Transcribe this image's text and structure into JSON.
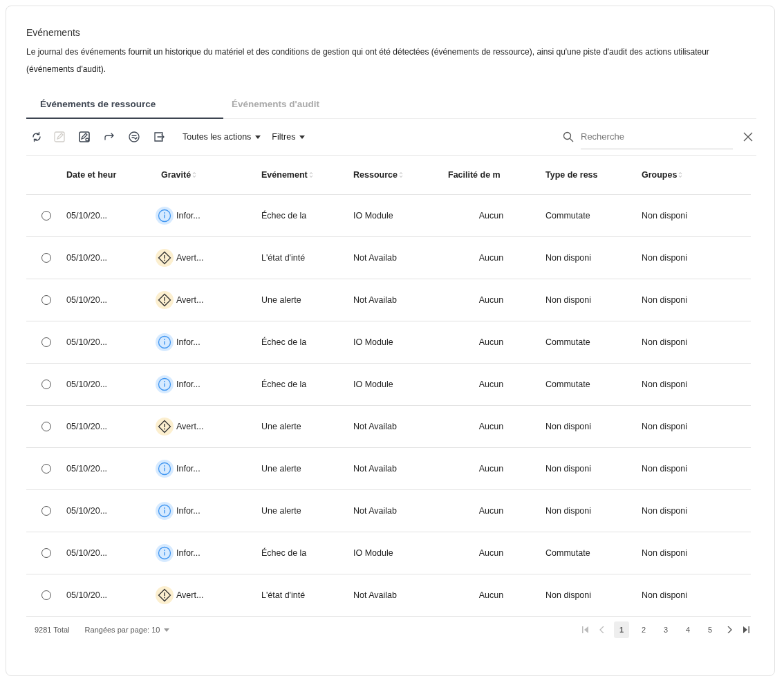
{
  "title": "Evénements",
  "description": "Le journal des événements fournit un historique du matériel et des conditions de gestion qui ont été détectées (événements de ressource), ainsi qu'une piste d'audit des actions utilisateur (événements d'audit).",
  "tabs": [
    {
      "label": "Événements de ressource",
      "selected": true
    },
    {
      "label": "Événements d'audit",
      "selected": false
    }
  ],
  "toolbar_icons": [
    {
      "kind": "refresh",
      "disabled": false
    },
    {
      "kind": "edit",
      "disabled": true
    },
    {
      "kind": "edit-settings",
      "disabled": false
    },
    {
      "kind": "forward",
      "disabled": false
    },
    {
      "kind": "list-circle",
      "disabled": false
    },
    {
      "kind": "export",
      "disabled": false
    }
  ],
  "menus": [
    "Toutes les actions",
    "Filtres"
  ],
  "search": {
    "placeholder": "Recherche"
  },
  "columns": [
    {
      "label": "Date et heur",
      "sortable": false
    },
    {
      "label": "Gravité",
      "sortable": true
    },
    {
      "label": "Evénement",
      "sortable": true
    },
    {
      "label": "Ressource",
      "sortable": true
    },
    {
      "label": "Facilité de m",
      "sortable": false
    },
    {
      "label": "Type de ress",
      "sortable": false
    },
    {
      "label": "Groupes",
      "sortable": true
    }
  ],
  "rows": [
    {
      "selected": false,
      "date": "05/10/20...",
      "severity": {
        "kind": "info",
        "label": "Infor..."
      },
      "event": "Échec de la",
      "resource": "IO Module",
      "facility": "Aucun",
      "type": "Commutate",
      "groups": "Non disponi"
    },
    {
      "selected": false,
      "date": "05/10/20...",
      "severity": {
        "kind": "warning",
        "label": "Avert..."
      },
      "event": "L'état d'inté",
      "resource": "Not Availab",
      "facility": "Aucun",
      "type": "Non disponi",
      "groups": "Non disponi"
    },
    {
      "selected": false,
      "date": "05/10/20...",
      "severity": {
        "kind": "warning",
        "label": "Avert..."
      },
      "event": "Une alerte",
      "resource": "Not Availab",
      "facility": "Aucun",
      "type": "Non disponi",
      "groups": "Non disponi"
    },
    {
      "selected": false,
      "date": "05/10/20...",
      "severity": {
        "kind": "info",
        "label": "Infor..."
      },
      "event": "Échec de la",
      "resource": "IO Module",
      "facility": "Aucun",
      "type": "Commutate",
      "groups": "Non disponi"
    },
    {
      "selected": false,
      "date": "05/10/20...",
      "severity": {
        "kind": "info",
        "label": "Infor..."
      },
      "event": "Échec de la",
      "resource": "IO Module",
      "facility": "Aucun",
      "type": "Commutate",
      "groups": "Non disponi"
    },
    {
      "selected": false,
      "date": "05/10/20...",
      "severity": {
        "kind": "warning",
        "label": "Avert..."
      },
      "event": "Une alerte",
      "resource": "Not Availab",
      "facility": "Aucun",
      "type": "Non disponi",
      "groups": "Non disponi"
    },
    {
      "selected": false,
      "date": "05/10/20...",
      "severity": {
        "kind": "info",
        "label": "Infor..."
      },
      "event": "Une alerte",
      "resource": "Not Availab",
      "facility": "Aucun",
      "type": "Non disponi",
      "groups": "Non disponi"
    },
    {
      "selected": false,
      "date": "05/10/20...",
      "severity": {
        "kind": "info",
        "label": "Infor..."
      },
      "event": "Une alerte",
      "resource": "Not Availab",
      "facility": "Aucun",
      "type": "Non disponi",
      "groups": "Non disponi"
    },
    {
      "selected": false,
      "date": "05/10/20...",
      "severity": {
        "kind": "info",
        "label": "Infor..."
      },
      "event": "Échec de la",
      "resource": "IO Module",
      "facility": "Aucun",
      "type": "Commutate",
      "groups": "Non disponi"
    },
    {
      "selected": false,
      "date": "05/10/20...",
      "severity": {
        "kind": "warning",
        "label": "Avert..."
      },
      "event": "L'état d'inté",
      "resource": "Not Availab",
      "facility": "Aucun",
      "type": "Non disponi",
      "groups": "Non disponi"
    }
  ],
  "footer": {
    "total": "9281 Total",
    "rows_per_page": "Rangées par page: 10",
    "pages": [
      {
        "label": "1",
        "selected": true
      },
      {
        "label": "2",
        "selected": false
      },
      {
        "label": "3",
        "selected": false
      },
      {
        "label": "4",
        "selected": false
      },
      {
        "label": "5",
        "selected": false
      }
    ]
  }
}
